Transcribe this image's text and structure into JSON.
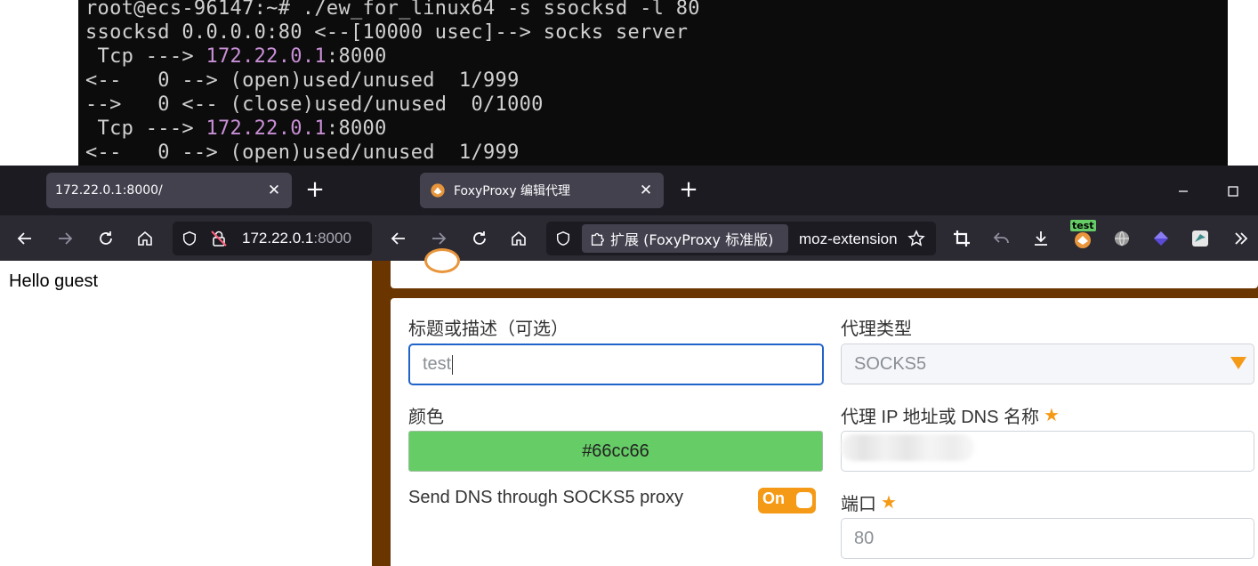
{
  "terminal": {
    "lines": [
      {
        "pre": "root@ecs-96147:~# ./ew_for_linux64 -s ssocksd -l 80",
        "ip": "",
        "post": ""
      },
      {
        "pre": "ssocksd 0.0.0.0:80 <--[10000 usec]--> socks server",
        "ip": "",
        "post": ""
      },
      {
        "pre": " Tcp ---> ",
        "ip": "172.22.0.1",
        "post": ":8000"
      },
      {
        "pre": "<--   0 --> (open)used/unused  1/999",
        "ip": "",
        "post": ""
      },
      {
        "pre": "-->   0 <-- (close)used/unused  0/1000",
        "ip": "",
        "post": ""
      },
      {
        "pre": " Tcp ---> ",
        "ip": "172.22.0.1",
        "post": ":8000"
      },
      {
        "pre": "<--   0 --> (open)used/unused  1/999",
        "ip": "",
        "post": ""
      }
    ]
  },
  "left_browser": {
    "tab_title": "172.22.0.1:8000/",
    "url_host": "172.22.0.1",
    "url_port": ":8000",
    "page_text": "Hello guest"
  },
  "right_browser": {
    "tab_title": "FoxyProxy 编辑代理",
    "ext_label": "扩展 (FoxyProxy 标准版)",
    "url_text": "moz-extension",
    "badge_text": "test"
  },
  "form": {
    "title_label": "标题或描述（可选）",
    "title_value": "test",
    "color_label": "颜色",
    "color_value": "#66cc66",
    "dns_label": "Send DNS through SOCKS5 proxy",
    "dns_toggle": "On",
    "type_label": "代理类型",
    "type_value": "SOCKS5",
    "ip_label": "代理 IP 地址或 DNS 名称",
    "port_label": "端口",
    "port_value": "80"
  },
  "colors": {
    "accent": "#f59a16",
    "focus": "#2064c9",
    "brand_brown": "#6b3500",
    "terminal_ip": "#c98fd6"
  }
}
